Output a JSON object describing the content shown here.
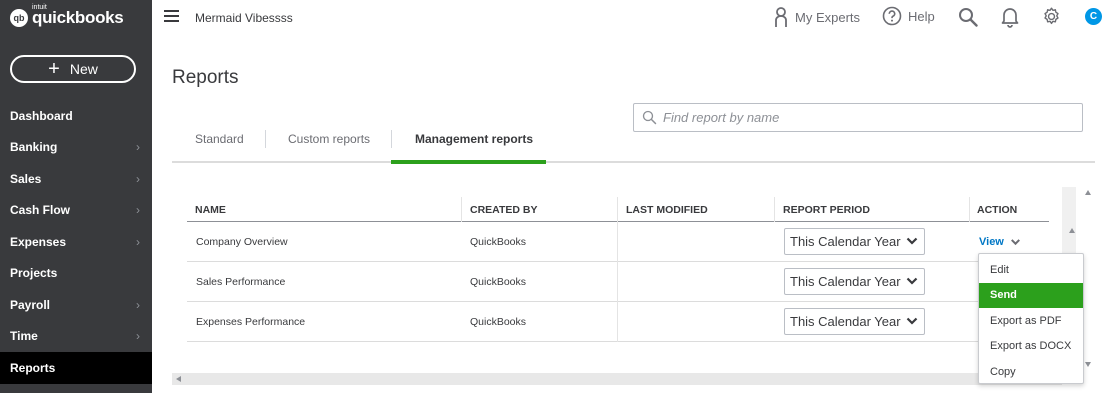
{
  "brand": {
    "badge": "qb",
    "intuit": "intuit",
    "name": "quickbooks"
  },
  "sidebar": {
    "new_label": "New",
    "items": [
      {
        "label": "Dashboard",
        "chevron": false
      },
      {
        "label": "Banking",
        "chevron": true
      },
      {
        "label": "Sales",
        "chevron": true
      },
      {
        "label": "Cash Flow",
        "chevron": true
      },
      {
        "label": "Expenses",
        "chevron": true
      },
      {
        "label": "Projects",
        "chevron": false
      },
      {
        "label": "Payroll",
        "chevron": true
      },
      {
        "label": "Time",
        "chevron": true
      },
      {
        "label": "Reports",
        "chevron": false,
        "active": true
      }
    ],
    "chevron_glyph": "›"
  },
  "topbar": {
    "company": "Mermaid Vibessss",
    "my_experts": "My Experts",
    "help": "Help",
    "avatar_initial": "C"
  },
  "page": {
    "title": "Reports"
  },
  "tabs": [
    {
      "label": "Standard"
    },
    {
      "label": "Custom reports"
    },
    {
      "label": "Management reports",
      "active": true
    }
  ],
  "search": {
    "placeholder": "Find report by name"
  },
  "table": {
    "headers": [
      "NAME",
      "CREATED BY",
      "LAST MODIFIED",
      "REPORT PERIOD",
      "ACTION"
    ],
    "rows": [
      {
        "name": "Company Overview",
        "created_by": "QuickBooks",
        "last_modified": "",
        "period": "This Calendar Year",
        "action": "View"
      },
      {
        "name": "Sales Performance",
        "created_by": "QuickBooks",
        "last_modified": "",
        "period": "This Calendar Year",
        "action": ""
      },
      {
        "name": "Expenses Performance",
        "created_by": "QuickBooks",
        "last_modified": "",
        "period": "This Calendar Year",
        "action": ""
      }
    ]
  },
  "action_menu": {
    "items": [
      "Edit",
      "Send",
      "Export as PDF",
      "Export as DOCX",
      "Copy"
    ],
    "highlighted": "Send"
  },
  "colors": {
    "sidebar_bg": "#393a3d",
    "accent_green": "#2ca01c",
    "link_blue": "#0077c5",
    "avatar_blue": "#0097e6"
  },
  "icons": {
    "logo": "quickbooks-logo-icon",
    "menu": "hamburger-icon",
    "experts": "person-icon",
    "help": "question-circle-icon",
    "search": "search-icon",
    "notifications": "bell-icon",
    "settings": "gear-icon",
    "dropdown": "chevron-down-icon"
  }
}
